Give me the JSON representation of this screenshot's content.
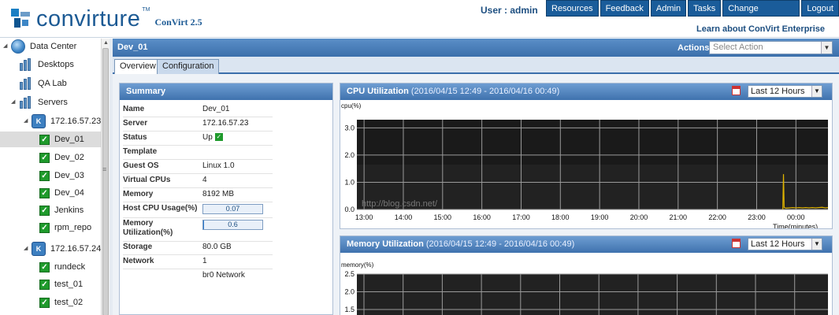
{
  "header": {
    "logo_text": "convirture",
    "logo_tm": "TM",
    "version": "ConVirt 2.5",
    "user_label": "User : admin",
    "nav": [
      "Resources",
      "Feedback",
      "Admin",
      "Tasks",
      "Change Password",
      "Logout"
    ],
    "learn_link": "Learn about ConVirt Enterprise"
  },
  "tree": {
    "datacenter": "Data Center",
    "desktops": "Desktops",
    "qa_lab": "QA Lab",
    "servers": "Servers",
    "host1": "172.16.57.23",
    "host1_vms": [
      "Dev_01",
      "Dev_02",
      "Dev_03",
      "Dev_04",
      "Jenkins",
      "rpm_repo"
    ],
    "host2": "172.16.57.24",
    "host2_vms": [
      "rundeck",
      "test_01",
      "test_02"
    ],
    "selected": "Dev_01"
  },
  "main": {
    "title": "Dev_01",
    "actions_label": "Actions",
    "select_action_placeholder": "Select Action",
    "tabs": [
      "Overview",
      "Configuration"
    ],
    "active_tab": "Overview"
  },
  "summary": {
    "title": "Summary",
    "rows": [
      {
        "k": "Name",
        "v": "Dev_01"
      },
      {
        "k": "Server",
        "v": "172.16.57.23"
      },
      {
        "k": "Status",
        "v": "Up"
      },
      {
        "k": "Template",
        "v": ""
      },
      {
        "k": "Guest OS",
        "v": "Linux 1.0"
      },
      {
        "k": "Virtual CPUs",
        "v": "4"
      },
      {
        "k": "Memory",
        "v": "8192 MB"
      },
      {
        "k": "Host CPU Usage(%)",
        "v": "0.07"
      },
      {
        "k": "Memory Utilization(%)",
        "v": "0.6"
      },
      {
        "k": "Storage",
        "v": "80.0 GB"
      },
      {
        "k": "Network",
        "v": "1"
      },
      {
        "k": "",
        "v": "br0 Network"
      }
    ],
    "host_cpu_pct": 0.07,
    "mem_util_pct": 0.6
  },
  "cpu_chart": {
    "title": "CPU Utilization",
    "range": "(2016/04/15 12:49 - 2016/04/16 00:49)",
    "period": "Last 12 Hours",
    "ylabel": "cpu(%)",
    "xlabel": "Time(minutes)"
  },
  "mem_chart": {
    "title": "Memory Utilization",
    "range": "(2016/04/15 12:49 - 2016/04/16 00:49)",
    "period": "Last 12 Hours",
    "ylabel": "memory(%)"
  },
  "watermark": "http://blog.csdn.net/",
  "colors": {
    "accent": "#1a5c9a",
    "panel_head": "#3f72ae",
    "plot_bg": "#222222",
    "series": "#e0b400",
    "check_green": "#1f9a2c"
  },
  "chart_data": [
    {
      "type": "line",
      "title": "CPU Utilization",
      "xlabel": "Time(minutes)",
      "ylabel": "cpu(%)",
      "x_ticks": [
        "13:00",
        "14:00",
        "15:00",
        "16:00",
        "17:00",
        "18:00",
        "19:00",
        "20:00",
        "21:00",
        "22:00",
        "23:00",
        "00:00"
      ],
      "y_ticks": [
        0.0,
        1.0,
        2.0,
        3.0
      ],
      "ylim": [
        0,
        3.3
      ],
      "x_range": [
        "12:49",
        "00:49"
      ],
      "grid": true,
      "series": [
        {
          "x": [
            "23:40",
            "23:41",
            "23:42",
            "23:45",
            "23:50",
            "23:55",
            "00:00",
            "00:05",
            "00:10",
            "00:15",
            "00:20",
            "00:25",
            "00:30",
            "00:35",
            "00:40",
            "00:45",
            "00:49"
          ],
          "values": [
            0.0,
            1.3,
            0.07,
            0.05,
            0.06,
            0.07,
            0.06,
            0.07,
            0.06,
            0.07,
            0.06,
            0.07,
            0.06,
            0.07,
            0.08,
            0.06,
            0.07
          ]
        }
      ]
    },
    {
      "type": "line",
      "title": "Memory Utilization",
      "ylabel": "memory(%)",
      "y_ticks": [
        1.5,
        2.0,
        2.5
      ],
      "ylim": [
        1.3,
        2.55
      ],
      "grid": true,
      "series": []
    }
  ]
}
